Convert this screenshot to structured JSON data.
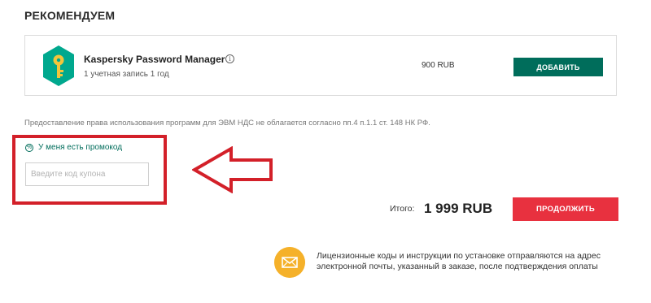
{
  "section": {
    "title": "РЕКОМЕНДУЕМ"
  },
  "product": {
    "name": "Kaspersky Password Manager",
    "subtitle": "1 учетная запись 1 год",
    "price": "900 RUB",
    "add_label": "ДОБАВИТЬ",
    "info_icon": "i"
  },
  "vat_note": "Предоставление права использования программ для ЭВМ НДС не облагается согласно пп.4 п.1.1 ст. 148 НК РФ.",
  "promo": {
    "link_label": "У меня есть промокод",
    "percent_icon": "%",
    "input_placeholder": "Введите код купона",
    "input_value": ""
  },
  "total": {
    "label": "Итого:",
    "value": "1 999 RUB"
  },
  "continue_label": "ПРОДОЛЖИТЬ",
  "license_note": "Лицензионные коды и инструкции по установке отправляются на адрес электронной почты, указанный в заказе, после подтверждения оплаты",
  "colors": {
    "brand_green": "#006d5b",
    "accent_red": "#e8313f",
    "highlight_red": "#d32029",
    "mail_yellow": "#f5b12a"
  },
  "icons": {
    "product": "key-shield-icon",
    "info": "info-icon",
    "promo": "percent-icon",
    "mail": "envelope-icon",
    "annotation": "arrow-left-icon"
  }
}
